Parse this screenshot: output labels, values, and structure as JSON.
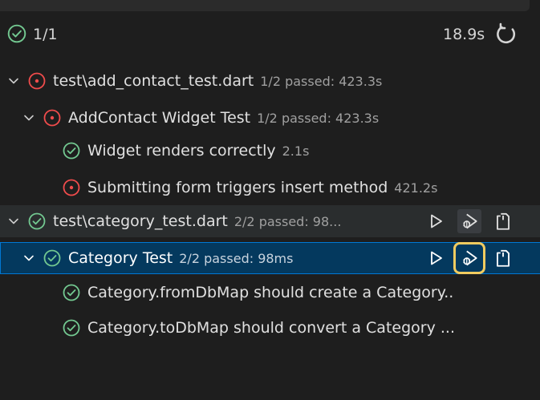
{
  "summary": {
    "count": "1/1",
    "duration": "18.9s"
  },
  "tree": {
    "file1": {
      "label": "test\\add_contact_test.dart",
      "meta": "1/2 passed: 423.3s",
      "status": "failed"
    },
    "group1": {
      "label": "AddContact Widget Test",
      "meta": "1/2 passed: 423.3s",
      "status": "failed"
    },
    "test1": {
      "label": "Widget renders correctly",
      "meta": "2.1s",
      "status": "passed"
    },
    "test2": {
      "label": "Submitting form triggers insert method",
      "meta": "421.2s",
      "status": "failed"
    },
    "file2": {
      "label": "test\\category_test.dart",
      "meta": "2/2 passed: 98...",
      "status": "passed"
    },
    "group2": {
      "label": "Category Test",
      "meta": "2/2 passed: 98ms",
      "status": "passed"
    },
    "test3": {
      "label": "Category.fromDbMap should create a Category..",
      "status": "passed"
    },
    "test4": {
      "label": "Category.toDbMap should convert a Category ...",
      "status": "passed"
    }
  },
  "colors": {
    "passed": "#73c991",
    "failed": "#f14c4c",
    "selected_bg": "#04395e",
    "highlight": "#f2cc60"
  },
  "icons": {
    "pass": "check-circle-icon",
    "fail": "error-circle-icon",
    "expand": "chevron-down-icon",
    "refresh": "refresh-icon",
    "run": "run-test-icon",
    "debug": "debug-test-icon",
    "goto": "go-to-file-icon"
  }
}
